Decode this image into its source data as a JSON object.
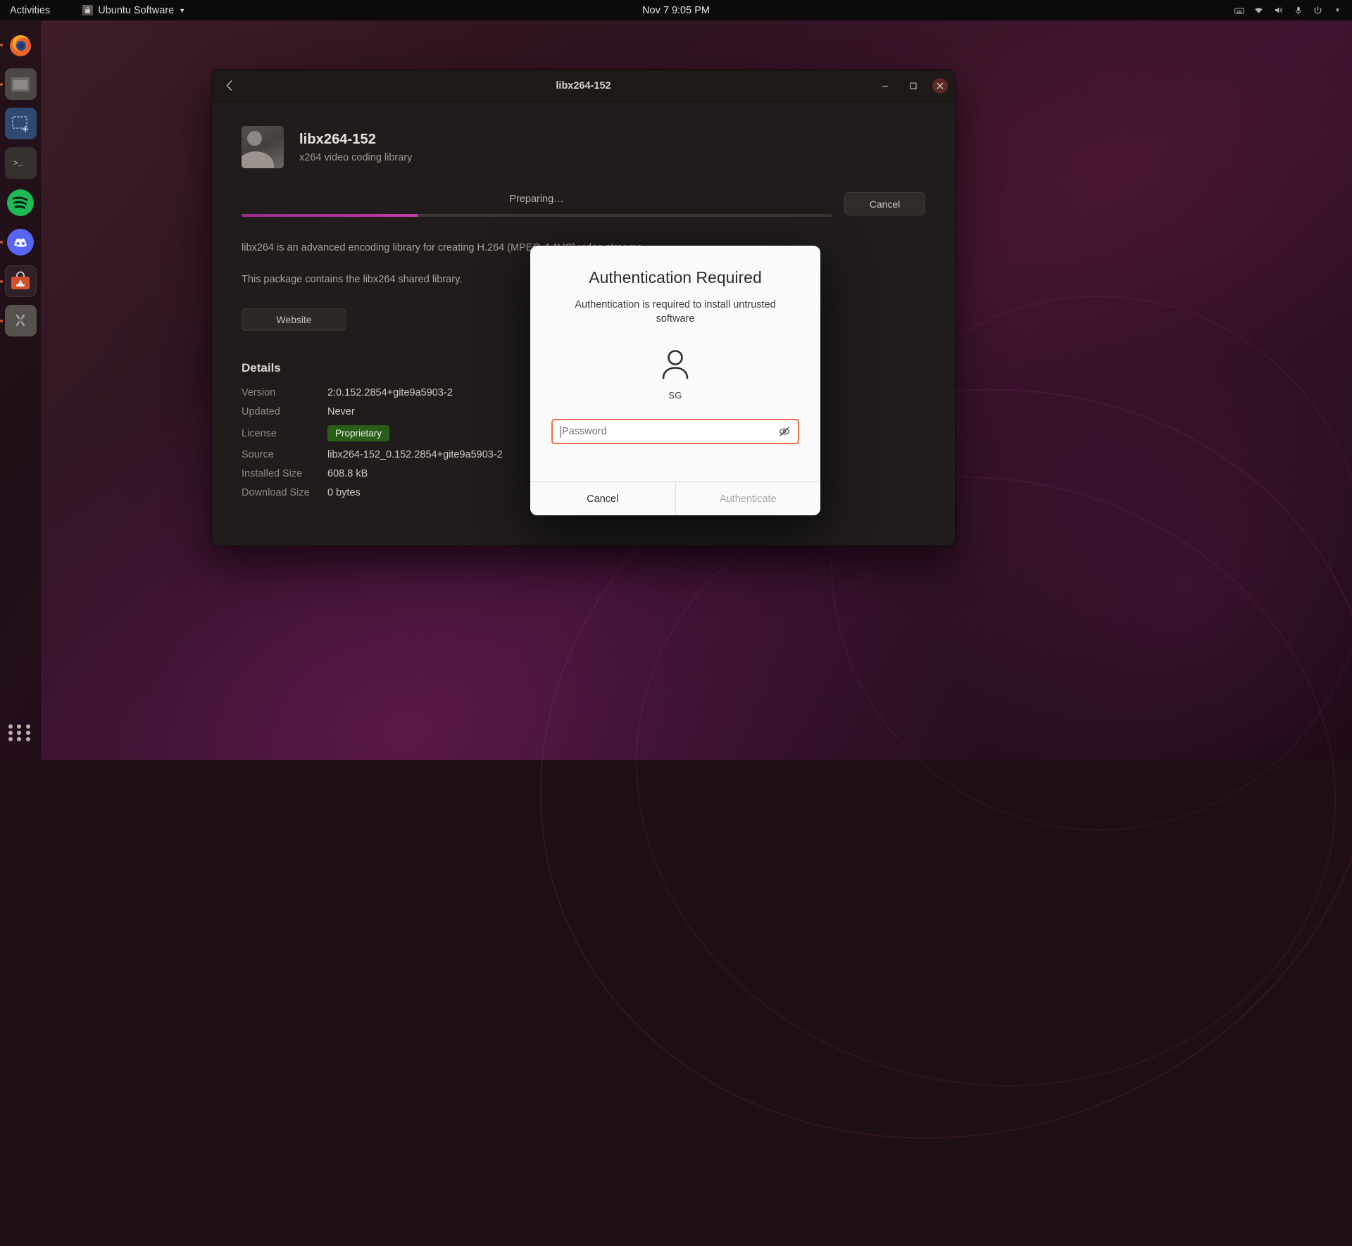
{
  "topbar": {
    "activities": "Activities",
    "app_menu": "Ubuntu Software",
    "app_menu_icon": "ubuntu-software-icon",
    "app_menu_chevron": "chevron-down-icon",
    "clock": "Nov 7  9:05 PM",
    "tray_icons": [
      "keyboard-icon",
      "network-icon",
      "volume-icon",
      "microphone-icon",
      "power-icon",
      "chevron-down-icon"
    ]
  },
  "dock": {
    "items": [
      {
        "name": "firefox",
        "label": "Firefox",
        "running": true
      },
      {
        "name": "files",
        "label": "Files",
        "running": true
      },
      {
        "name": "screenshot",
        "label": "Screenshot",
        "running": false
      },
      {
        "name": "terminal",
        "label": "Terminal",
        "running": false
      },
      {
        "name": "spotify",
        "label": "Spotify",
        "running": false
      },
      {
        "name": "discord",
        "label": "Discord",
        "running": true
      },
      {
        "name": "ubuntu-software",
        "label": "Ubuntu Software",
        "running": true
      },
      {
        "name": "tools",
        "label": "Tools",
        "running": true
      }
    ],
    "show_apps": "show-applications"
  },
  "window": {
    "title": "libx264-152",
    "back_icon": "chevron-left-icon",
    "minimize_icon": "minimize-icon",
    "maximize_icon": "maximize-icon",
    "close_icon": "close-icon"
  },
  "package": {
    "icon": "package-placeholder-icon",
    "name": "libx264-152",
    "summary": "x264 video coding library",
    "progress_label": "Preparing…",
    "progress_percent": 30,
    "cancel_label": "Cancel",
    "description_1": "libx264 is an advanced encoding library for creating H.264 (MPEG-4 AVC) video streams.",
    "description_2": "This package contains the libx264 shared library.",
    "website_label": "Website"
  },
  "details": {
    "heading": "Details",
    "rows": [
      {
        "key": "Version",
        "value": "2:0.152.2854+gite9a5903-2",
        "badge": false
      },
      {
        "key": "Updated",
        "value": "Never",
        "badge": false
      },
      {
        "key": "License",
        "value": "Proprietary",
        "badge": true
      },
      {
        "key": "Source",
        "value": "libx264-152_0.152.2854+gite9a5903-2",
        "badge": false
      },
      {
        "key": "Installed Size",
        "value": "608.8 kB",
        "badge": false
      },
      {
        "key": "Download Size",
        "value": "0 bytes",
        "badge": false
      }
    ]
  },
  "auth_dialog": {
    "title": "Authentication Required",
    "message": "Authentication is required to install untrusted software",
    "avatar_icon": "user-avatar-icon",
    "username": "SG",
    "password_placeholder": "Password",
    "password_value": "",
    "reveal_icon": "eye-slash-icon",
    "cancel_label": "Cancel",
    "authenticate_label": "Authenticate"
  },
  "colors": {
    "accent_orange": "#e8704a",
    "progress_magenta": "#b1329b",
    "license_green": "#2a5e18",
    "close_red": "#5b2b23"
  }
}
